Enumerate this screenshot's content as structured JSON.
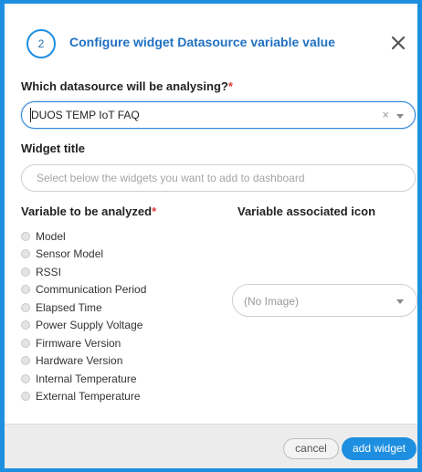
{
  "header": {
    "step": "2",
    "title": "Configure widget Datasource variable value"
  },
  "datasource": {
    "label": "Which datasource will be analysing?",
    "required_mark": "*",
    "value": "DUOS TEMP IoT FAQ",
    "clear_glyph": "×"
  },
  "widget_title": {
    "label": "Widget title",
    "placeholder": "Select below the widgets you want to add to dashboard",
    "value": ""
  },
  "variables": {
    "label": "Variable to be analyzed",
    "required_mark": "*",
    "options": [
      "Model",
      "Sensor Model",
      "RSSI",
      "Communication Period",
      "Elapsed Time",
      "Power Supply Voltage",
      "Firmware Version",
      "Hardware Version",
      "Internal Temperature",
      "External Temperature"
    ]
  },
  "icon": {
    "label": "Variable associated icon",
    "selected": "(No Image)"
  },
  "footer": {
    "cancel_label": "cancel",
    "add_label": "add widget"
  },
  "colors": {
    "accent": "#1e8fe0",
    "title": "#1f70c1",
    "required": "#e03a3a",
    "footer_bg": "#ececec"
  }
}
